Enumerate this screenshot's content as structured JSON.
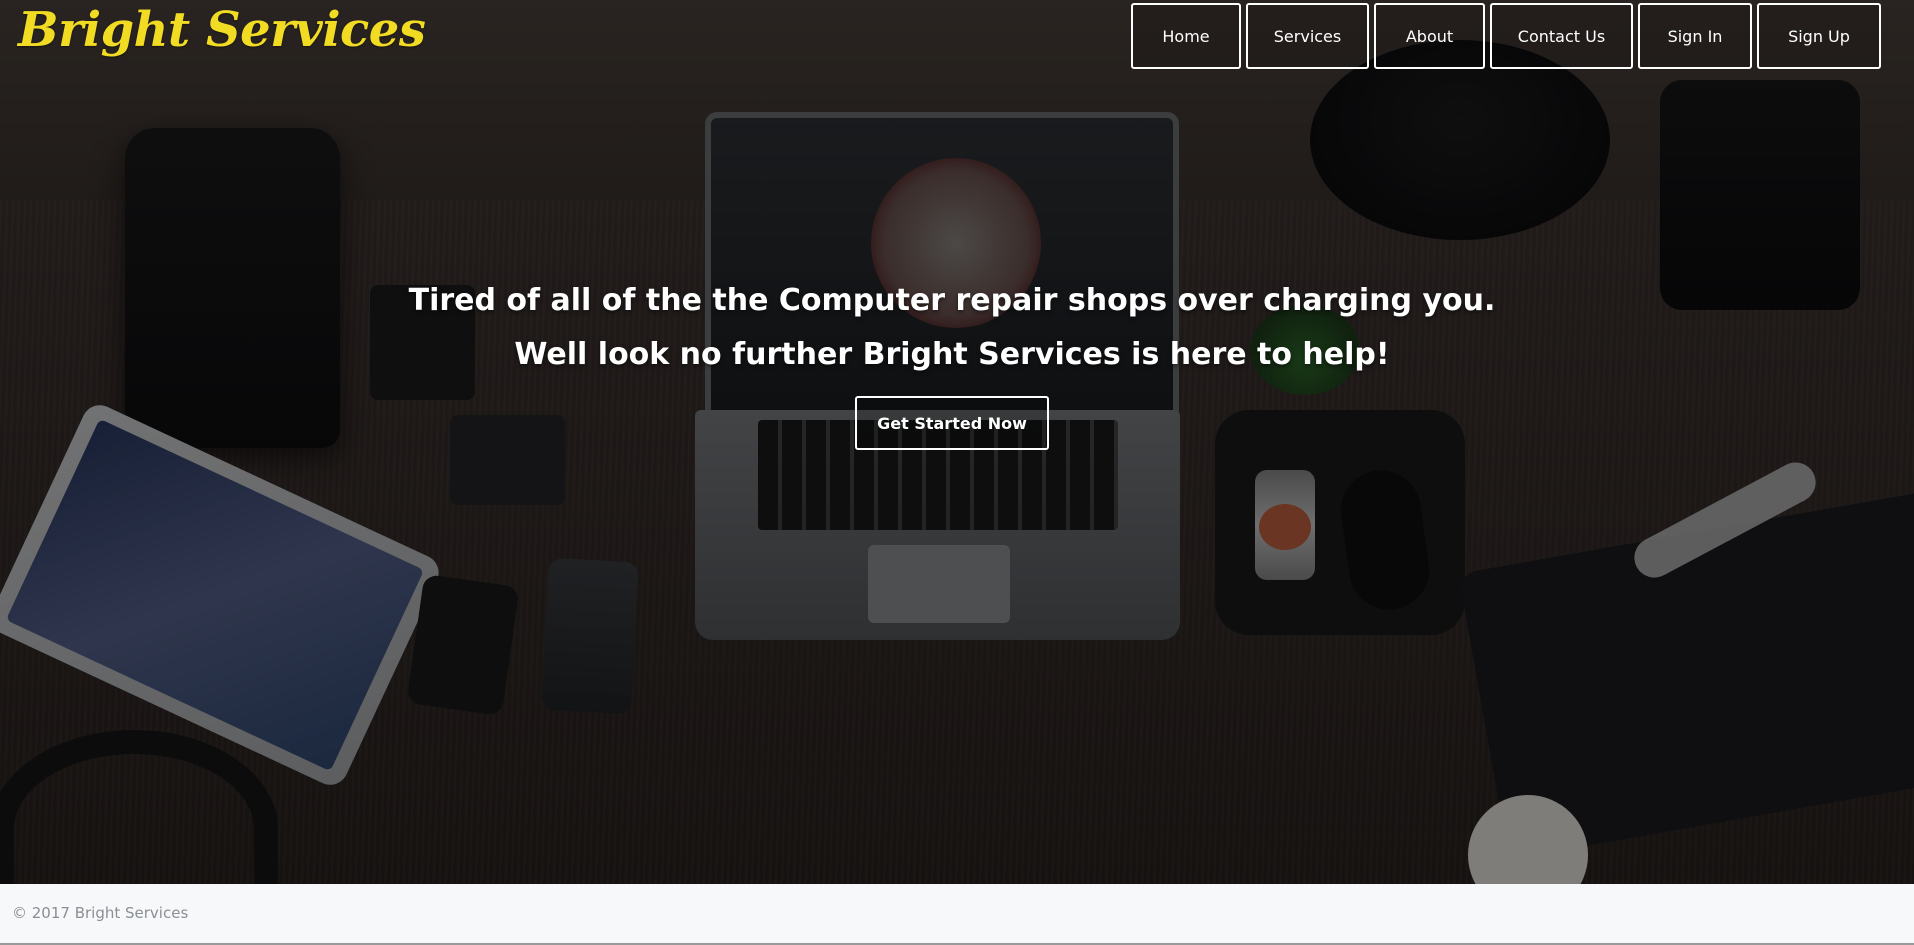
{
  "brand": {
    "name": "Bright Services",
    "color": "#f2dc23"
  },
  "nav": {
    "items": [
      {
        "label": "Home"
      },
      {
        "label": "Services"
      },
      {
        "label": "About"
      },
      {
        "label": "Contact Us"
      },
      {
        "label": "Sign In"
      },
      {
        "label": "Sign Up"
      }
    ]
  },
  "hero": {
    "headline_line1": "Tired of all of the the Computer repair shops over charging you.",
    "headline_line2": "Well look no further Bright Services is here to help!",
    "cta_label": "Get Started Now"
  },
  "footer": {
    "copyright": "© 2017 Bright Services"
  }
}
